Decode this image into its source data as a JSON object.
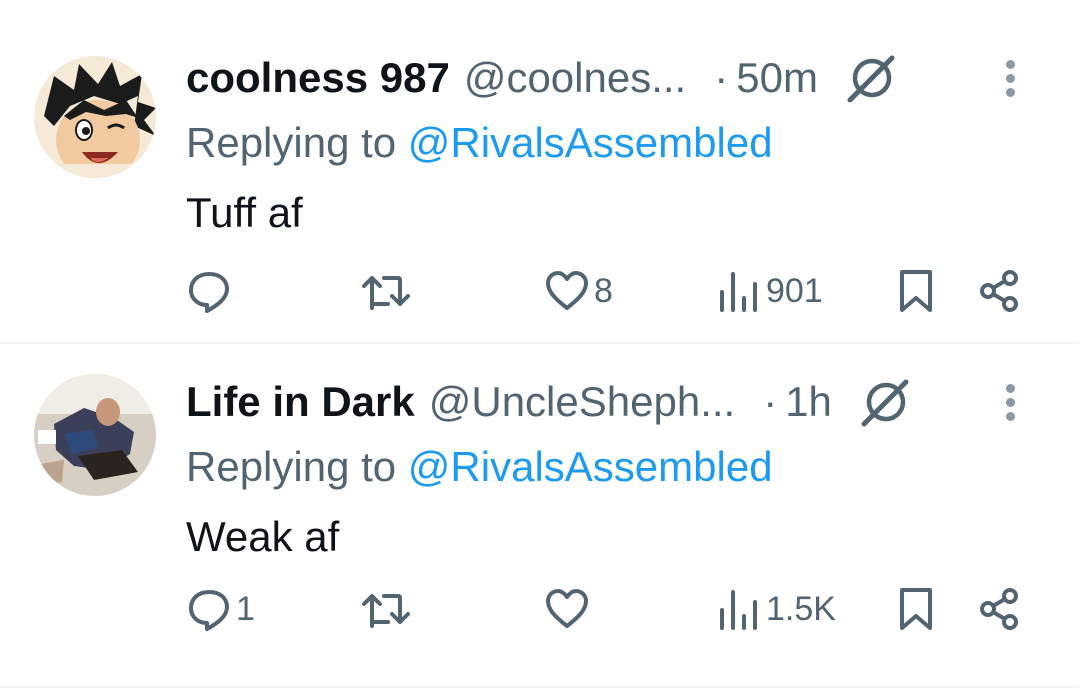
{
  "tweets": [
    {
      "name": "coolness 987",
      "handle": "@coolnes...",
      "dot": "·",
      "time": "50m",
      "replying_prefix": "Replying to ",
      "replying_mention": "@RivalsAssembled",
      "text": "Tuff af",
      "stats": {
        "replies": "",
        "retweets": "",
        "likes": "8",
        "views": "901"
      },
      "avatar": "anime-boy-avatar"
    },
    {
      "name": "Life in Dark",
      "handle": "@UncleSheph...",
      "dot": "·",
      "time": "1h",
      "replying_prefix": "Replying to ",
      "replying_mention": "@RivalsAssembled",
      "text": "Weak af",
      "stats": {
        "replies": "1",
        "retweets": "",
        "likes": "",
        "views": "1.5K"
      },
      "avatar": "photo-avatar"
    }
  ],
  "icons": [
    "reply-icon",
    "retweet-icon",
    "like-icon",
    "views-icon",
    "bookmark-icon",
    "share-icon",
    "grok-icon",
    "more-icon"
  ],
  "colors": {
    "text": "#0f1419",
    "secondary": "#536471",
    "link": "#1d9bf0",
    "divider": "#eff3f4"
  }
}
